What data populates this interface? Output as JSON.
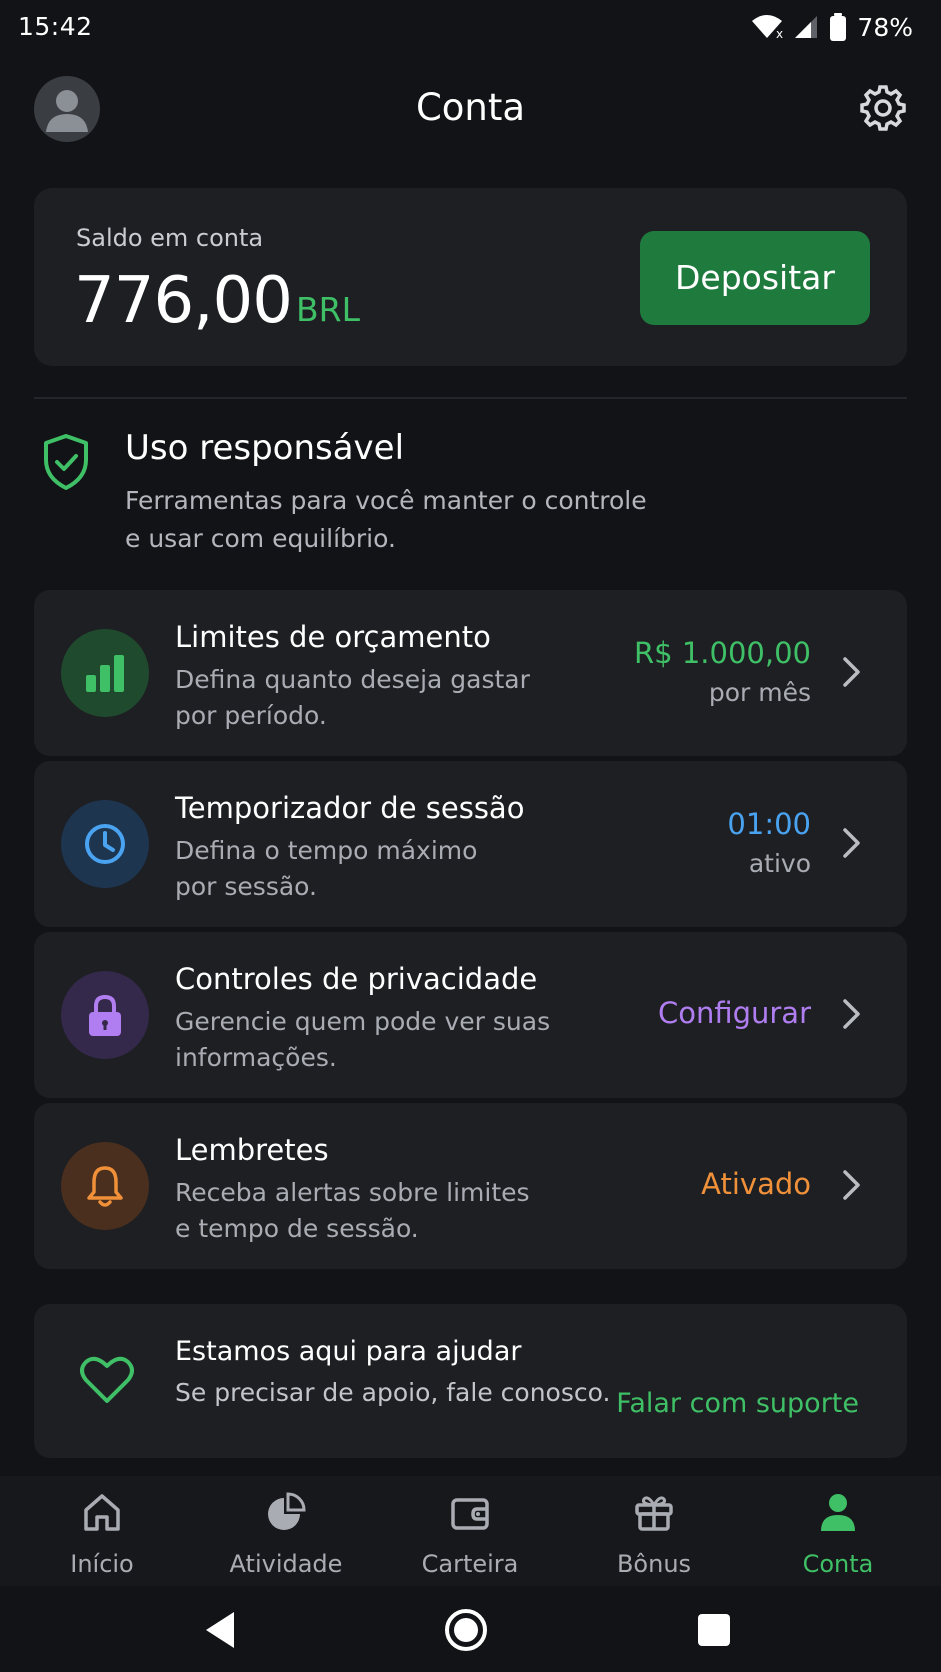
{
  "status_bar": {
    "time": "15:42",
    "battery": "78%"
  },
  "header": {
    "title": "Conta"
  },
  "balance": {
    "label": "Saldo em conta",
    "amount": "776,00",
    "currency": "BRL",
    "deposit_label": "Depositar"
  },
  "responsible": {
    "title": "Uso responsável",
    "description_line1": "Ferramentas para você manter o controle",
    "description_line2": "e usar com equilíbrio."
  },
  "items": [
    {
      "title": "Limites de orçamento",
      "desc_line1": "Defina quanto deseja gastar",
      "desc_line2": "por período.",
      "value": "R$ 1.000,00",
      "sub": "por mês",
      "icon": "bar-chart-icon",
      "accent": "#3fbf66"
    },
    {
      "title": "Temporizador de sessão",
      "desc_line1": "Defina o tempo máximo",
      "desc_line2": "por sessão.",
      "value": "01:00",
      "sub": "ativo",
      "icon": "clock-icon",
      "accent": "#4aa3f0"
    },
    {
      "title": "Controles de privacidade",
      "desc_line1": "Gerencie quem pode ver suas",
      "desc_line2": "informações.",
      "value": "Configurar",
      "icon": "lock-icon",
      "accent": "#b07ef0"
    },
    {
      "title": "Lembretes",
      "desc_line1": "Receba alertas sobre limites",
      "desc_line2": "e tempo de sessão.",
      "value": "Ativado",
      "icon": "bell-icon",
      "accent": "#f0913a"
    }
  ],
  "support": {
    "title": "Estamos aqui para ajudar",
    "description": "Se precisar de apoio, fale conosco.",
    "link": "Falar com suporte"
  },
  "nav": [
    {
      "label": "Início",
      "icon": "home-icon"
    },
    {
      "label": "Atividade",
      "icon": "pie-chart-icon"
    },
    {
      "label": "Carteira",
      "icon": "wallet-icon"
    },
    {
      "label": "Bônus",
      "icon": "gift-icon"
    },
    {
      "label": "Conta",
      "icon": "user-icon",
      "active": true
    }
  ],
  "colors": {
    "background": "#121316",
    "card": "#1d1f23",
    "accent_green": "#3fbf66",
    "deposit_button": "#1f7a3d"
  }
}
